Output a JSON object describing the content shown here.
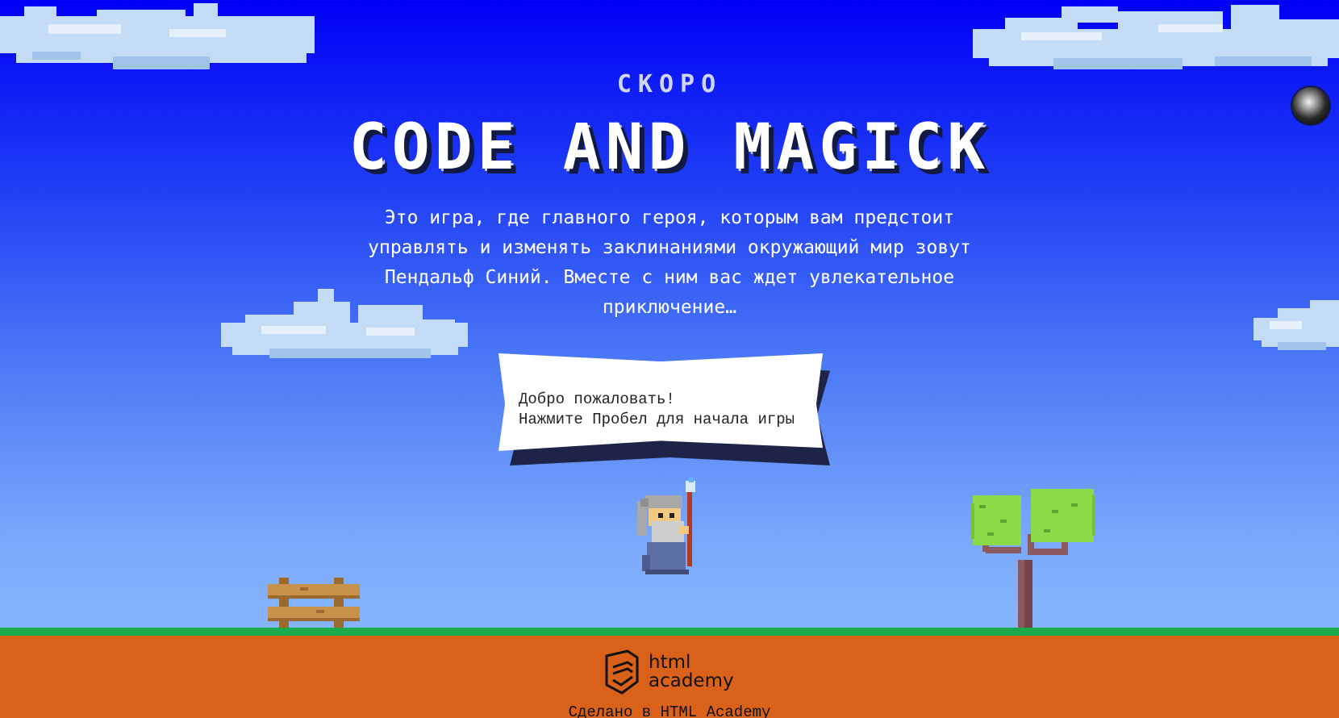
{
  "header": {
    "subtitle": "СКОРО",
    "title": "CODE AND MAGICK"
  },
  "description": "Это игра, где главного героя, которым вам предстоит управлять и изменять заклинаниями окружающий мир зовут Пендальф Синий. Вместе с ним вас ждет увлекательное приключение…",
  "message": {
    "line1": "Добро пожаловать!",
    "line2": "Нажмите Пробел для начала игры"
  },
  "footer": {
    "logo_line1": "html",
    "logo_line2": "academy",
    "note": "Сделано в HTML Academy"
  },
  "icons": {
    "avatar": "user-avatar-icon",
    "logo": "html-academy-logo-icon"
  },
  "colors": {
    "sky_top": "#0000f5",
    "sky_bottom": "#94c2fd",
    "grass": "#1aaa4c",
    "ground": "#d96119",
    "message_shadow": "#1d2448"
  }
}
